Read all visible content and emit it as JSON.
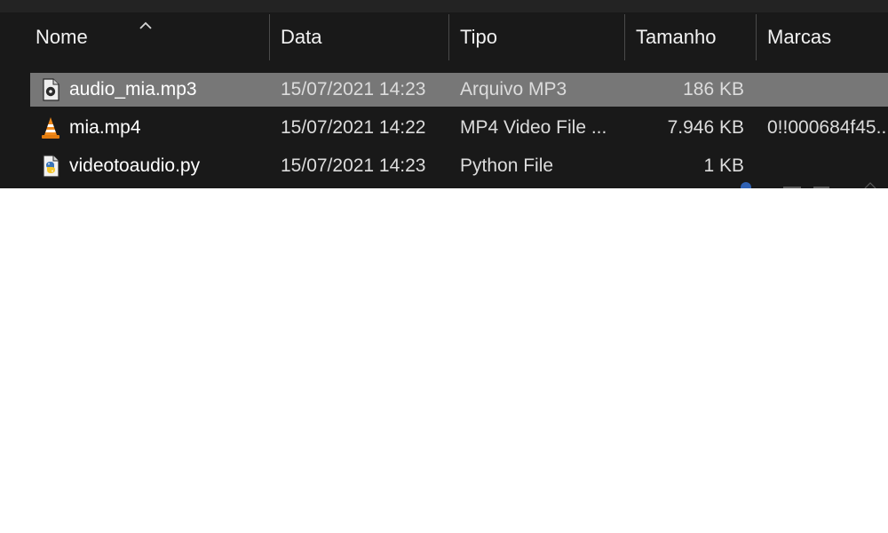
{
  "header": {
    "columns": [
      "Nome",
      "Data",
      "Tipo",
      "Tamanho",
      "Marcas"
    ],
    "sort_icon": "chevron-up-icon"
  },
  "files": [
    {
      "name": "audio_mia.mp3",
      "date": "15/07/2021 14:23",
      "type": "Arquivo MP3",
      "size": "186 KB",
      "tags": "",
      "icon": "audio-file-icon",
      "selected": true
    },
    {
      "name": "mia.mp4",
      "date": "15/07/2021 14:22",
      "type": "MP4 Video File ...",
      "size": "7.946 KB",
      "tags": "0!!000684f45...",
      "icon": "vlc-cone-icon",
      "selected": false
    },
    {
      "name": "videotoaudio.py",
      "date": "15/07/2021 14:23",
      "type": "Python File",
      "size": "1 KB",
      "tags": "",
      "icon": "python-file-icon",
      "selected": false
    }
  ],
  "colors": {
    "background": "#191919",
    "selected_row": "#777777",
    "text": "#ffffff"
  }
}
